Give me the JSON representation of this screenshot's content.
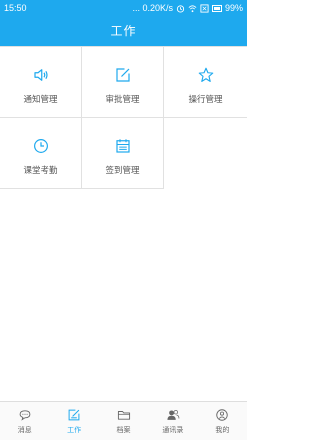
{
  "status_bar": {
    "time": "15:50",
    "speed": "... 0.20K/s",
    "battery": "99%"
  },
  "header": {
    "title": "工作"
  },
  "grid": {
    "items": [
      {
        "label": "通知管理",
        "icon": "speaker-icon"
      },
      {
        "label": "审批管理",
        "icon": "edit-icon"
      },
      {
        "label": "操行管理",
        "icon": "star-icon"
      },
      {
        "label": "课堂考勤",
        "icon": "clock-icon"
      },
      {
        "label": "签到管理",
        "icon": "calendar-icon"
      }
    ]
  },
  "tabbar": {
    "items": [
      {
        "label": "消息",
        "icon": "chat-icon",
        "active": false
      },
      {
        "label": "工作",
        "icon": "work-icon",
        "active": true
      },
      {
        "label": "档案",
        "icon": "folder-icon",
        "active": false
      },
      {
        "label": "通讯录",
        "icon": "contacts-icon",
        "active": false
      },
      {
        "label": "我的",
        "icon": "profile-icon",
        "active": false
      }
    ]
  },
  "colors": {
    "accent": "#1ea9ee",
    "divider": "#e1e1e1",
    "label": "#555555"
  }
}
